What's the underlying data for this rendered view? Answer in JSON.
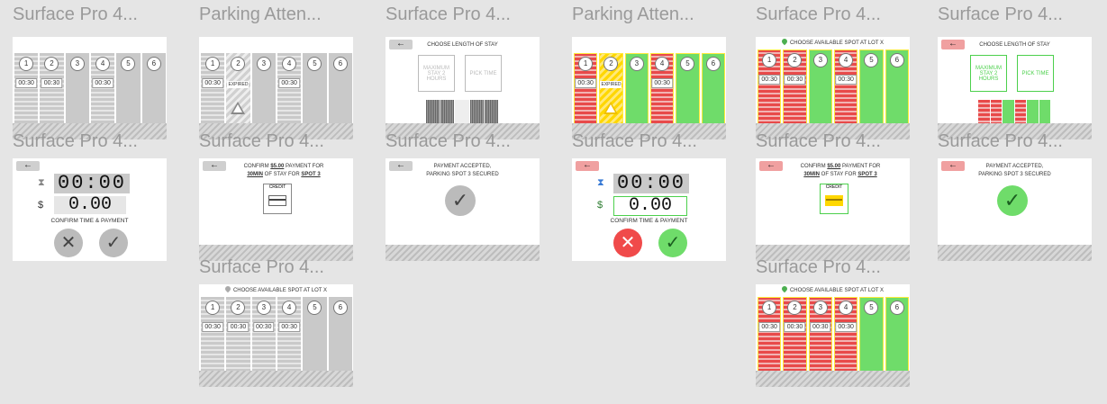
{
  "tiles": [
    {
      "title": "Surface Pro 4..."
    },
    {
      "title": "Parking Atten..."
    },
    {
      "title": "Surface Pro 4..."
    },
    {
      "title": "Parking Atten..."
    },
    {
      "title": "Surface Pro 4..."
    },
    {
      "title": "Surface Pro 4..."
    },
    {
      "title": "Surface Pro 4..."
    },
    {
      "title": "Surface Pro 4..."
    },
    {
      "title": "Surface Pro 4..."
    },
    {
      "title": "Surface Pro 4..."
    },
    {
      "title": "Surface Pro 4..."
    },
    {
      "title": "Surface Pro 4..."
    },
    {
      "title": "Surface Pro 4..."
    },
    {
      "title": "Surface Pro 4..."
    }
  ],
  "labels": {
    "spot_numbers": [
      "1",
      "2",
      "3",
      "4",
      "5",
      "6"
    ],
    "time_30": "00:30",
    "expired": "EXPIRED",
    "choose_length": "CHOOSE LENGTH OF STAY",
    "choose_spot": "CHOOSE AVAILABLE SPOT AT LOT X",
    "max_stay": "MAXIMUM STAY 2 HOURS",
    "pick_time": "PICK TIME",
    "clock": "00:00",
    "cash": "0.00",
    "confirm_time_payment": "CONFIRM TIME & PAYMENT",
    "confirm_pay_pre": "CONFIRM ",
    "confirm_pay_amount": "$5.00",
    "confirm_pay_mid": " PAYMENT FOR",
    "confirm_min": "30MIN",
    "confirm_of_stay": " OF STAY FOR ",
    "confirm_spot": "SPOT 3",
    "credit": "CREDIT",
    "payment_accepted": "PAYMENT ACCEPTED,",
    "spot_secured": "PARKING SPOT 3 SECURED",
    "back_arrow": "←",
    "x": "✕",
    "check": "✓",
    "hourglass": "⧗",
    "dollar": "$"
  },
  "icons": [
    "back-arrow-icon",
    "location-pin-icon",
    "warning-icon",
    "hourglass-icon",
    "credit-card-icon",
    "check-icon",
    "close-icon"
  ],
  "colors": {
    "occupied": "#e84a4a",
    "available": "#6fdc6a",
    "expired": "#ffd700",
    "accent_green": "#4cd04c",
    "back_red": "#f0a0a0"
  }
}
